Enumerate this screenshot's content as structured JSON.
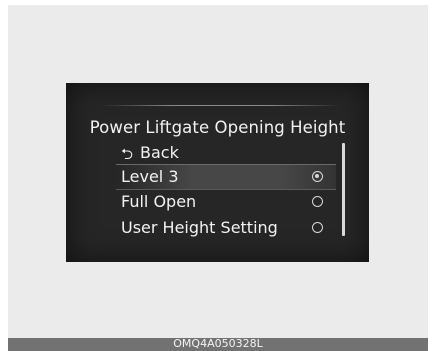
{
  "screen": {
    "title": "Power Liftgate Opening Height",
    "back": {
      "icon": "return-arrow-icon",
      "glyph": "⮌",
      "label": "Back"
    },
    "options": [
      {
        "label": "Level 3",
        "selected": true
      },
      {
        "label": "Full Open",
        "selected": false
      },
      {
        "label": "User Height Setting",
        "selected": false
      }
    ]
  },
  "figure_code": "OMQ4A050328L"
}
